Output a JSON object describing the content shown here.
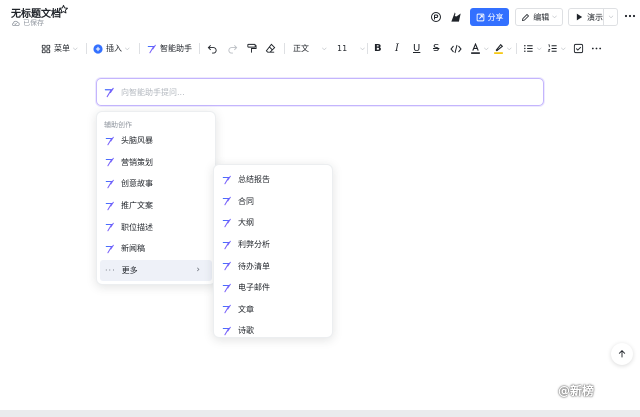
{
  "header": {
    "title": "无标题文档",
    "saved_status": "已保存",
    "share_label": "分享",
    "edit_label": "编辑",
    "present_label": "演示"
  },
  "toolbar": {
    "menu_label": "菜单",
    "insert_label": "插入",
    "ai_assistant_label": "智能助手",
    "paragraph_style": "正文",
    "font_size": "11"
  },
  "ai_input": {
    "placeholder": "向智能助手提问..."
  },
  "menu1": {
    "header": "辅助创作",
    "items": [
      "头脑风暴",
      "营销策划",
      "创意故事",
      "推广文案",
      "职位描述",
      "新闻稿"
    ],
    "more_label": "更多"
  },
  "menu2": {
    "items": [
      "总结报告",
      "合同",
      "大纲",
      "利弊分析",
      "待办清单",
      "电子邮件",
      "文章",
      "诗歌"
    ]
  },
  "watermark": {
    "text": "@新榜"
  },
  "colors": {
    "accent": "#3370ff",
    "ai_gradient_start": "#3370ff",
    "ai_gradient_end": "#a855f7"
  }
}
